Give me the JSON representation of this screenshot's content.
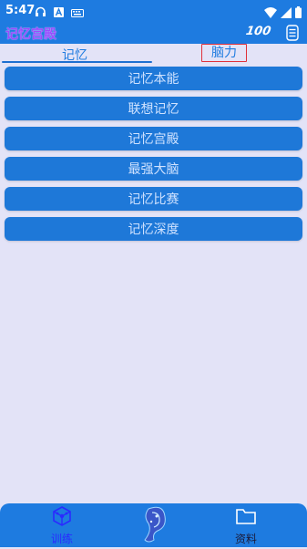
{
  "status_bar": {
    "time": "5:47",
    "icons": [
      "headset-icon",
      "text-a-icon",
      "keyboard-icon",
      "wifi-icon",
      "signal-icon",
      "battery-icon"
    ]
  },
  "app_bar": {
    "title": "记忆宫殿",
    "badge": "100",
    "menu_icon": "list-icon",
    "title_color": "#9a4bff"
  },
  "tabs": [
    {
      "label": "记忆",
      "selected": true
    },
    {
      "label": "脑力",
      "selected": false
    }
  ],
  "menu_items": [
    {
      "label": "记忆本能"
    },
    {
      "label": "联想记忆"
    },
    {
      "label": "记忆宫殿"
    },
    {
      "label": "最强大脑"
    },
    {
      "label": "记忆比赛"
    },
    {
      "label": "记忆深度"
    }
  ],
  "bottom_nav": {
    "items": [
      {
        "label": "训练",
        "icon": "cube-network-icon",
        "active": true
      },
      {
        "label": "",
        "icon": "brain-logo-icon",
        "active": false
      },
      {
        "label": "资料",
        "icon": "folder-icon",
        "active": false
      }
    ]
  },
  "colors": {
    "primary": "#1e7be0",
    "background": "#e3e3f7",
    "highlight_border": "#e0303a"
  }
}
